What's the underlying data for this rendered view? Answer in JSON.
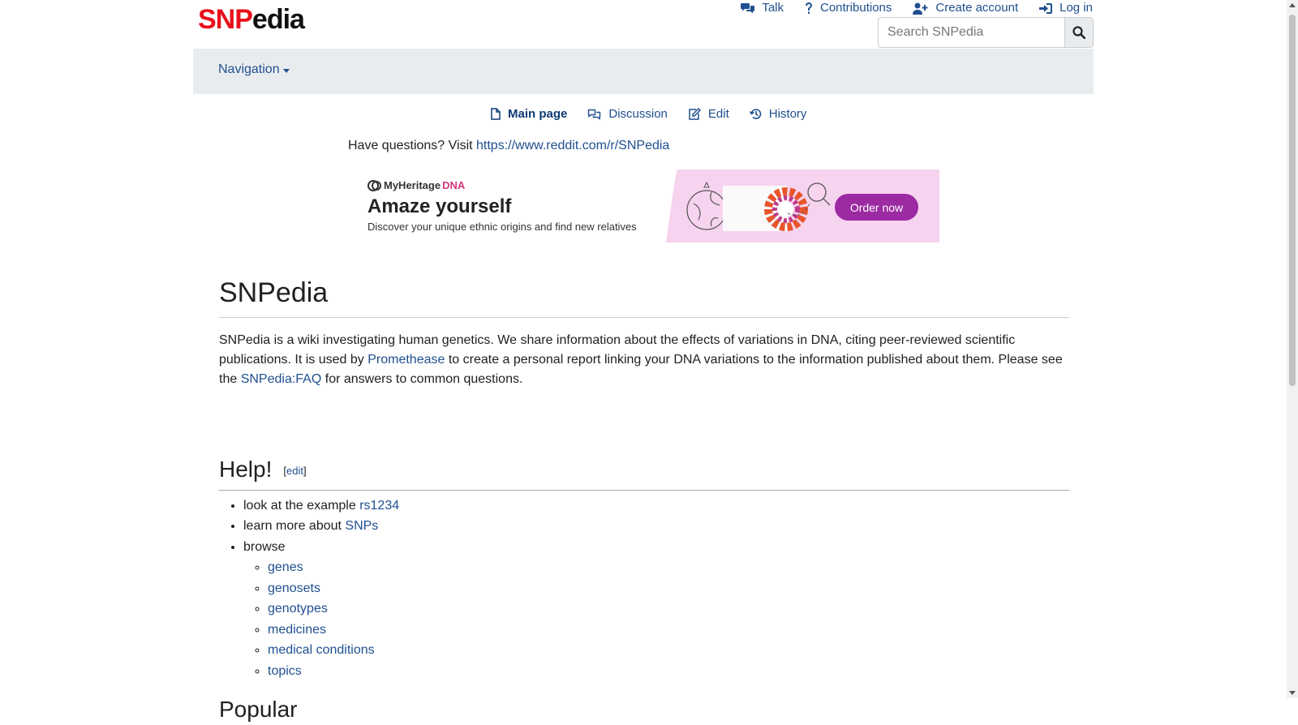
{
  "logo": {
    "part1": "SNP",
    "part2": "edia"
  },
  "personal": [
    {
      "label": "Talk",
      "icon": "comments-icon"
    },
    {
      "label": "Contributions",
      "icon": "question-icon"
    },
    {
      "label": "Create account",
      "icon": "user-plus-icon"
    },
    {
      "label": "Log in",
      "icon": "sign-in-icon"
    }
  ],
  "search": {
    "placeholder": "Search SNPedia"
  },
  "navbar": {
    "navigation": "Navigation"
  },
  "tabs": [
    {
      "label": "Main page",
      "icon": "file-icon",
      "active": true
    },
    {
      "label": "Discussion",
      "icon": "discussion-icon"
    },
    {
      "label": "Edit",
      "icon": "edit-icon"
    },
    {
      "label": "History",
      "icon": "history-icon"
    }
  ],
  "notice": {
    "text": "Have questions? Visit ",
    "link": "https://www.reddit.com/r/SNPedia"
  },
  "ad": {
    "brand": "MyHeritage",
    "brand_dna": "DNA",
    "headline": "Amaze yourself",
    "sub": "Discover your unique ethnic origins and find new relatives",
    "cta": "Order now"
  },
  "page": {
    "title": "SNPedia",
    "intro": {
      "t1": "SNPedia is a wiki investigating human genetics. We share information about the effects of variations in DNA, citing peer-reviewed scientific publications. It is used by ",
      "link1": "Promethease",
      "t2": " to create a personal report linking your DNA variations to the information published about them. Please see the ",
      "link2": "SNPedia:FAQ",
      "t3": " for answers to common questions."
    },
    "help": {
      "heading": "Help!",
      "edit": "edit",
      "item1_text": "look at the example ",
      "item1_link": "rs1234",
      "item2_text": "learn more about ",
      "item2_link": "SNPs",
      "item3_text": "browse",
      "browse": [
        "genes",
        "genosets",
        "genotypes",
        "medicines",
        "medical conditions",
        "topics"
      ]
    },
    "next_heading": "Popular"
  }
}
